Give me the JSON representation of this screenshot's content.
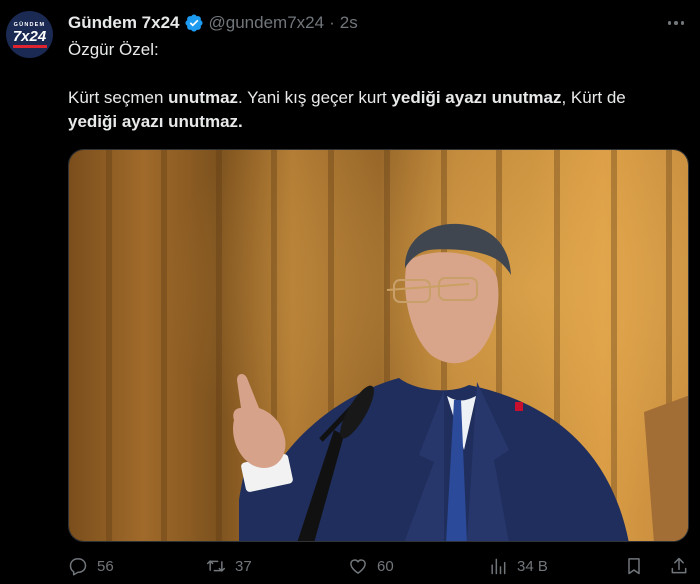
{
  "tweet": {
    "avatar": {
      "top_text": "GÜNDEM",
      "main_text": "7x24"
    },
    "author_name": "Gündem 7x24",
    "handle": "@gundem7x24",
    "separator": "·",
    "time": "2s",
    "text_lines": [
      [
        {
          "t": "Özgür Özel:",
          "b": false
        }
      ],
      [],
      [
        {
          "t": "Kürt seçmen ",
          "b": false
        },
        {
          "t": "unutmaz",
          "b": true
        },
        {
          "t": ". Yani kış geçer kurt ",
          "b": false
        },
        {
          "t": "yediği ayazı unutmaz",
          "b": true
        },
        {
          "t": ", Kürt de",
          "b": false
        }
      ],
      [
        {
          "t": "yediği ayazı unutmaz",
          "b": true
        },
        {
          "t": ".",
          "b": true
        }
      ]
    ],
    "actions": {
      "reply_count": "56",
      "retweet_count": "37",
      "like_count": "60",
      "views_count": "34 B"
    },
    "icons": [
      "verified-badge-icon",
      "more-icon",
      "reply-icon",
      "retweet-icon",
      "like-icon",
      "views-icon",
      "bookmark-icon",
      "share-icon"
    ],
    "colors": {
      "verified": "#1d9bf0",
      "muted": "#71767b",
      "text": "#e7e9ea",
      "background": "#000000"
    }
  }
}
